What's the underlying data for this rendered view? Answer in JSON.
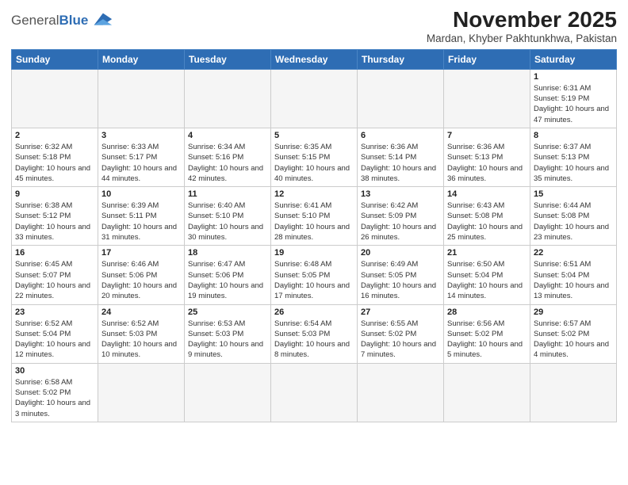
{
  "logo": {
    "text_normal": "General",
    "text_bold": "Blue"
  },
  "title": "November 2025",
  "subtitle": "Mardan, Khyber Pakhtunkhwa, Pakistan",
  "weekdays": [
    "Sunday",
    "Monday",
    "Tuesday",
    "Wednesday",
    "Thursday",
    "Friday",
    "Saturday"
  ],
  "weeks": [
    [
      {
        "day": "",
        "info": ""
      },
      {
        "day": "",
        "info": ""
      },
      {
        "day": "",
        "info": ""
      },
      {
        "day": "",
        "info": ""
      },
      {
        "day": "",
        "info": ""
      },
      {
        "day": "",
        "info": ""
      },
      {
        "day": "1",
        "info": "Sunrise: 6:31 AM\nSunset: 5:19 PM\nDaylight: 10 hours and 47 minutes."
      }
    ],
    [
      {
        "day": "2",
        "info": "Sunrise: 6:32 AM\nSunset: 5:18 PM\nDaylight: 10 hours and 45 minutes."
      },
      {
        "day": "3",
        "info": "Sunrise: 6:33 AM\nSunset: 5:17 PM\nDaylight: 10 hours and 44 minutes."
      },
      {
        "day": "4",
        "info": "Sunrise: 6:34 AM\nSunset: 5:16 PM\nDaylight: 10 hours and 42 minutes."
      },
      {
        "day": "5",
        "info": "Sunrise: 6:35 AM\nSunset: 5:15 PM\nDaylight: 10 hours and 40 minutes."
      },
      {
        "day": "6",
        "info": "Sunrise: 6:36 AM\nSunset: 5:14 PM\nDaylight: 10 hours and 38 minutes."
      },
      {
        "day": "7",
        "info": "Sunrise: 6:36 AM\nSunset: 5:13 PM\nDaylight: 10 hours and 36 minutes."
      },
      {
        "day": "8",
        "info": "Sunrise: 6:37 AM\nSunset: 5:13 PM\nDaylight: 10 hours and 35 minutes."
      }
    ],
    [
      {
        "day": "9",
        "info": "Sunrise: 6:38 AM\nSunset: 5:12 PM\nDaylight: 10 hours and 33 minutes."
      },
      {
        "day": "10",
        "info": "Sunrise: 6:39 AM\nSunset: 5:11 PM\nDaylight: 10 hours and 31 minutes."
      },
      {
        "day": "11",
        "info": "Sunrise: 6:40 AM\nSunset: 5:10 PM\nDaylight: 10 hours and 30 minutes."
      },
      {
        "day": "12",
        "info": "Sunrise: 6:41 AM\nSunset: 5:10 PM\nDaylight: 10 hours and 28 minutes."
      },
      {
        "day": "13",
        "info": "Sunrise: 6:42 AM\nSunset: 5:09 PM\nDaylight: 10 hours and 26 minutes."
      },
      {
        "day": "14",
        "info": "Sunrise: 6:43 AM\nSunset: 5:08 PM\nDaylight: 10 hours and 25 minutes."
      },
      {
        "day": "15",
        "info": "Sunrise: 6:44 AM\nSunset: 5:08 PM\nDaylight: 10 hours and 23 minutes."
      }
    ],
    [
      {
        "day": "16",
        "info": "Sunrise: 6:45 AM\nSunset: 5:07 PM\nDaylight: 10 hours and 22 minutes."
      },
      {
        "day": "17",
        "info": "Sunrise: 6:46 AM\nSunset: 5:06 PM\nDaylight: 10 hours and 20 minutes."
      },
      {
        "day": "18",
        "info": "Sunrise: 6:47 AM\nSunset: 5:06 PM\nDaylight: 10 hours and 19 minutes."
      },
      {
        "day": "19",
        "info": "Sunrise: 6:48 AM\nSunset: 5:05 PM\nDaylight: 10 hours and 17 minutes."
      },
      {
        "day": "20",
        "info": "Sunrise: 6:49 AM\nSunset: 5:05 PM\nDaylight: 10 hours and 16 minutes."
      },
      {
        "day": "21",
        "info": "Sunrise: 6:50 AM\nSunset: 5:04 PM\nDaylight: 10 hours and 14 minutes."
      },
      {
        "day": "22",
        "info": "Sunrise: 6:51 AM\nSunset: 5:04 PM\nDaylight: 10 hours and 13 minutes."
      }
    ],
    [
      {
        "day": "23",
        "info": "Sunrise: 6:52 AM\nSunset: 5:04 PM\nDaylight: 10 hours and 12 minutes."
      },
      {
        "day": "24",
        "info": "Sunrise: 6:52 AM\nSunset: 5:03 PM\nDaylight: 10 hours and 10 minutes."
      },
      {
        "day": "25",
        "info": "Sunrise: 6:53 AM\nSunset: 5:03 PM\nDaylight: 10 hours and 9 minutes."
      },
      {
        "day": "26",
        "info": "Sunrise: 6:54 AM\nSunset: 5:03 PM\nDaylight: 10 hours and 8 minutes."
      },
      {
        "day": "27",
        "info": "Sunrise: 6:55 AM\nSunset: 5:02 PM\nDaylight: 10 hours and 7 minutes."
      },
      {
        "day": "28",
        "info": "Sunrise: 6:56 AM\nSunset: 5:02 PM\nDaylight: 10 hours and 5 minutes."
      },
      {
        "day": "29",
        "info": "Sunrise: 6:57 AM\nSunset: 5:02 PM\nDaylight: 10 hours and 4 minutes."
      }
    ],
    [
      {
        "day": "30",
        "info": "Sunrise: 6:58 AM\nSunset: 5:02 PM\nDaylight: 10 hours and 3 minutes."
      },
      {
        "day": "",
        "info": ""
      },
      {
        "day": "",
        "info": ""
      },
      {
        "day": "",
        "info": ""
      },
      {
        "day": "",
        "info": ""
      },
      {
        "day": "",
        "info": ""
      },
      {
        "day": "",
        "info": ""
      }
    ]
  ]
}
